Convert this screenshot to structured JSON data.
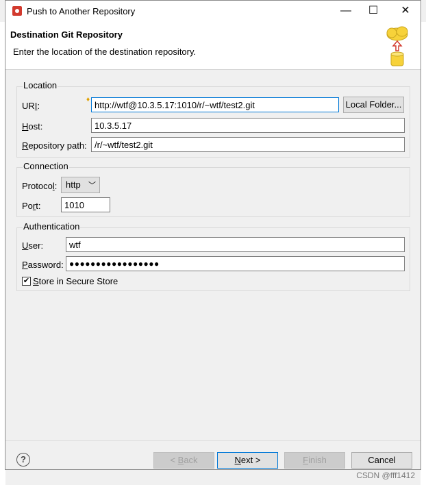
{
  "window": {
    "title": "Push to Another Repository",
    "minimize_glyph": "—",
    "maximize_glyph": "☐",
    "close_glyph": "✕"
  },
  "header": {
    "title": "Destination Git Repository",
    "subtitle": "Enter the location of the destination repository."
  },
  "location": {
    "group_title": "Location",
    "uri_label_pre": "UR",
    "uri_label_mnemonic": "I",
    "uri_label_post": ":",
    "uri_value": "http://wtf@10.3.5.17:1010/r/~wtf/test2.git",
    "local_folder_button": "Local Folder...",
    "host_label_mnemonic": "H",
    "host_label_post": "ost:",
    "host_value": "10.3.5.17",
    "repo_path_label_mnemonic": "R",
    "repo_path_label_post": "epository path:",
    "repo_path_value": "/r/~wtf/test2.git"
  },
  "connection": {
    "group_title": "Connection",
    "protocol_label_pre": "Protoco",
    "protocol_label_mnemonic": "l",
    "protocol_label_post": ":",
    "protocol_value": "http",
    "port_label_pre": "Po",
    "port_label_mnemonic": "r",
    "port_label_post": "t:",
    "port_value": "1010"
  },
  "authentication": {
    "group_title": "Authentication",
    "user_label_mnemonic": "U",
    "user_label_post": "ser:",
    "user_value": "wtf",
    "password_label_mnemonic": "P",
    "password_label_post": "assword:",
    "password_value": "●●●●●●●●●●●●●●●●●",
    "store_label_pre": "S",
    "store_label_rest": "tore in Secure Store",
    "store_checked": true
  },
  "footer": {
    "help_glyph": "?",
    "back_pre": "< ",
    "back_mnemonic": "B",
    "back_post": "ack",
    "next_mnemonic": "N",
    "next_post": "ext >",
    "finish_mnemonic": "F",
    "finish_post": "inish",
    "cancel": "Cancel"
  },
  "watermark": "CSDN @fff1412",
  "colors": {
    "accent": "#0078d7",
    "app_icon": "#d23a2e"
  }
}
